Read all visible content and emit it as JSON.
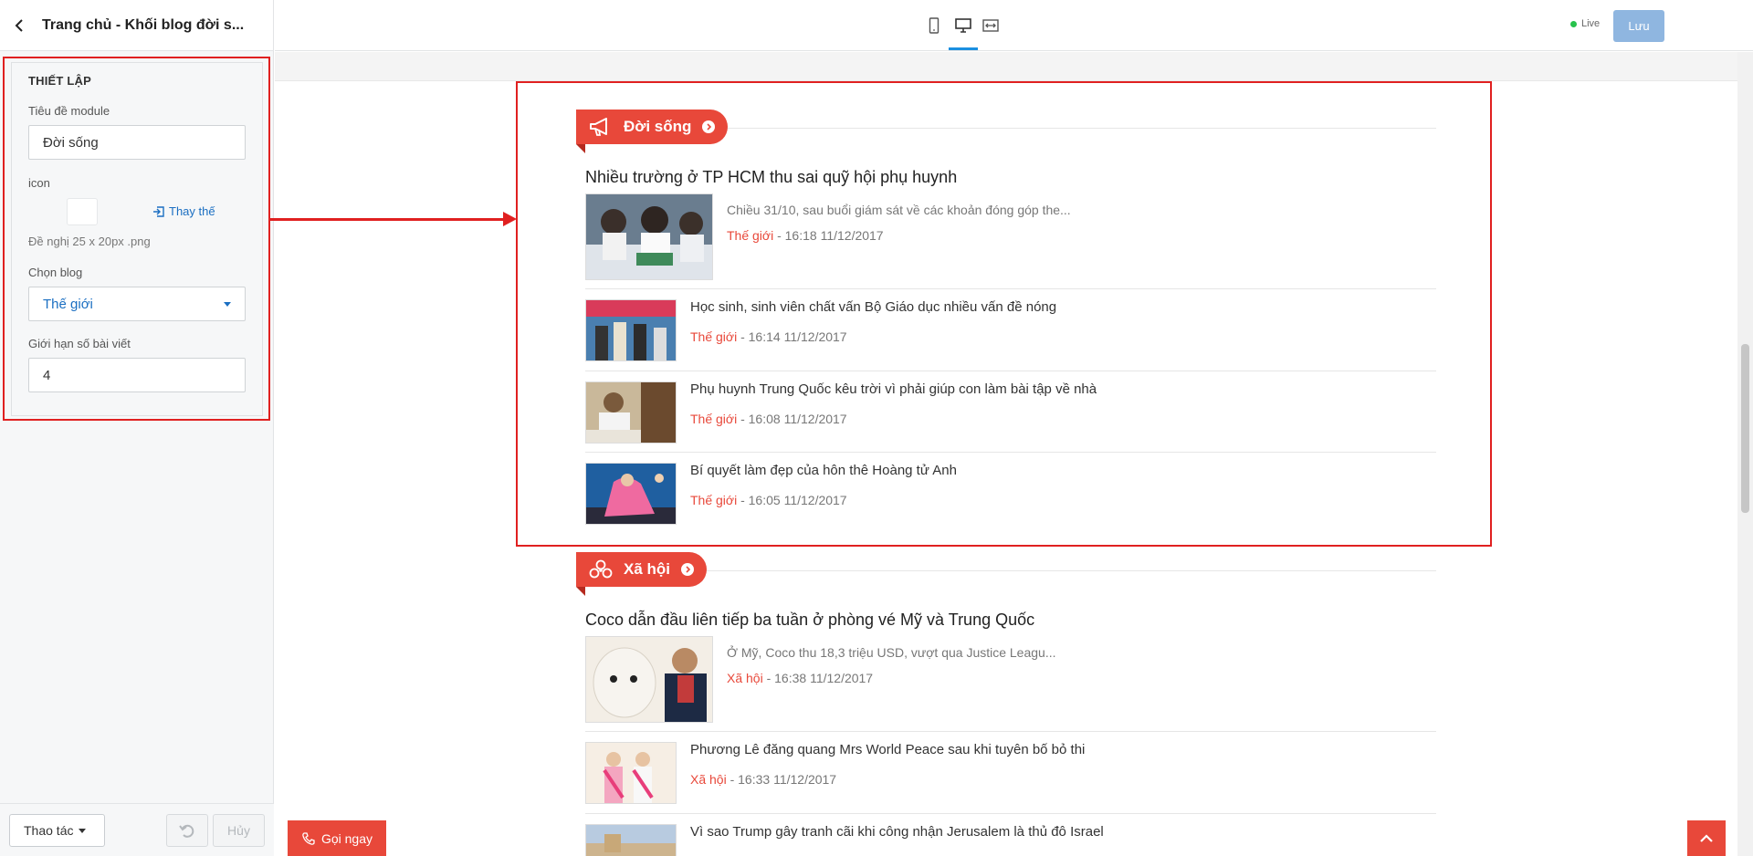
{
  "sidebar": {
    "title": "Trang chủ - Khối blog đời s...",
    "section_title": "THIẾT LẬP",
    "module_title_label": "Tiêu đề module",
    "module_title_value": "Đời sống",
    "icon_label": "icon",
    "replace_label": "Thay thế",
    "icon_hint": "Đề nghị 25 x 20px .png",
    "blog_label": "Chọn blog",
    "blog_value": "Thế giới",
    "limit_label": "Giới hạn số bài viết",
    "limit_value": "4",
    "actions_label": "Thao tác",
    "cancel_label": "Hủy"
  },
  "topbar": {
    "live_label": "Live",
    "save_label": "Lưu"
  },
  "preview": {
    "call_label": "Gọi ngay",
    "modules": [
      {
        "title": "Đời sống",
        "icon": "megaphone-icon",
        "featured": {
          "title": "Nhiều trường ở TP HCM thu sai quỹ hội phụ huynh",
          "excerpt": "Chiều 31/10, sau buổi giám sát về các khoản đóng góp the...",
          "category": "Thế giới",
          "time": " - 16:18 11/12/2017"
        },
        "items": [
          {
            "title": "Học sinh, sinh viên chất vấn Bộ Giáo dục nhiều vấn đề nóng",
            "category": "Thế giới",
            "time": " - 16:14 11/12/2017"
          },
          {
            "title": "Phụ huynh Trung Quốc kêu trời vì phải giúp con làm bài tập về nhà",
            "category": "Thế giới",
            "time": " - 16:08 11/12/2017"
          },
          {
            "title": "Bí quyết làm đẹp của hôn thê Hoàng tử Anh",
            "category": "Thế giới",
            "time": " - 16:05 11/12/2017"
          }
        ]
      },
      {
        "title": "Xã hội",
        "icon": "clover-icon",
        "featured": {
          "title": "Coco dẫn đầu liên tiếp ba tuần ở phòng vé Mỹ và Trung Quốc",
          "excerpt": "Ở Mỹ, Coco thu 18,3 triệu USD, vượt qua Justice Leagu...",
          "category": "Xã hội",
          "time": " - 16:38 11/12/2017"
        },
        "items": [
          {
            "title": "Phương Lê đăng quang Mrs World Peace sau khi tuyên bố bỏ thi",
            "category": "Xã hội",
            "time": " - 16:33 11/12/2017"
          },
          {
            "title": "Vì sao Trump gây tranh cãi khi công nhận Jerusalem là thủ đô Israel",
            "category": "",
            "time": ""
          }
        ]
      }
    ]
  },
  "colors": {
    "accent": "#e8483a",
    "link": "#1b6fc2",
    "annotation": "#e02020"
  }
}
